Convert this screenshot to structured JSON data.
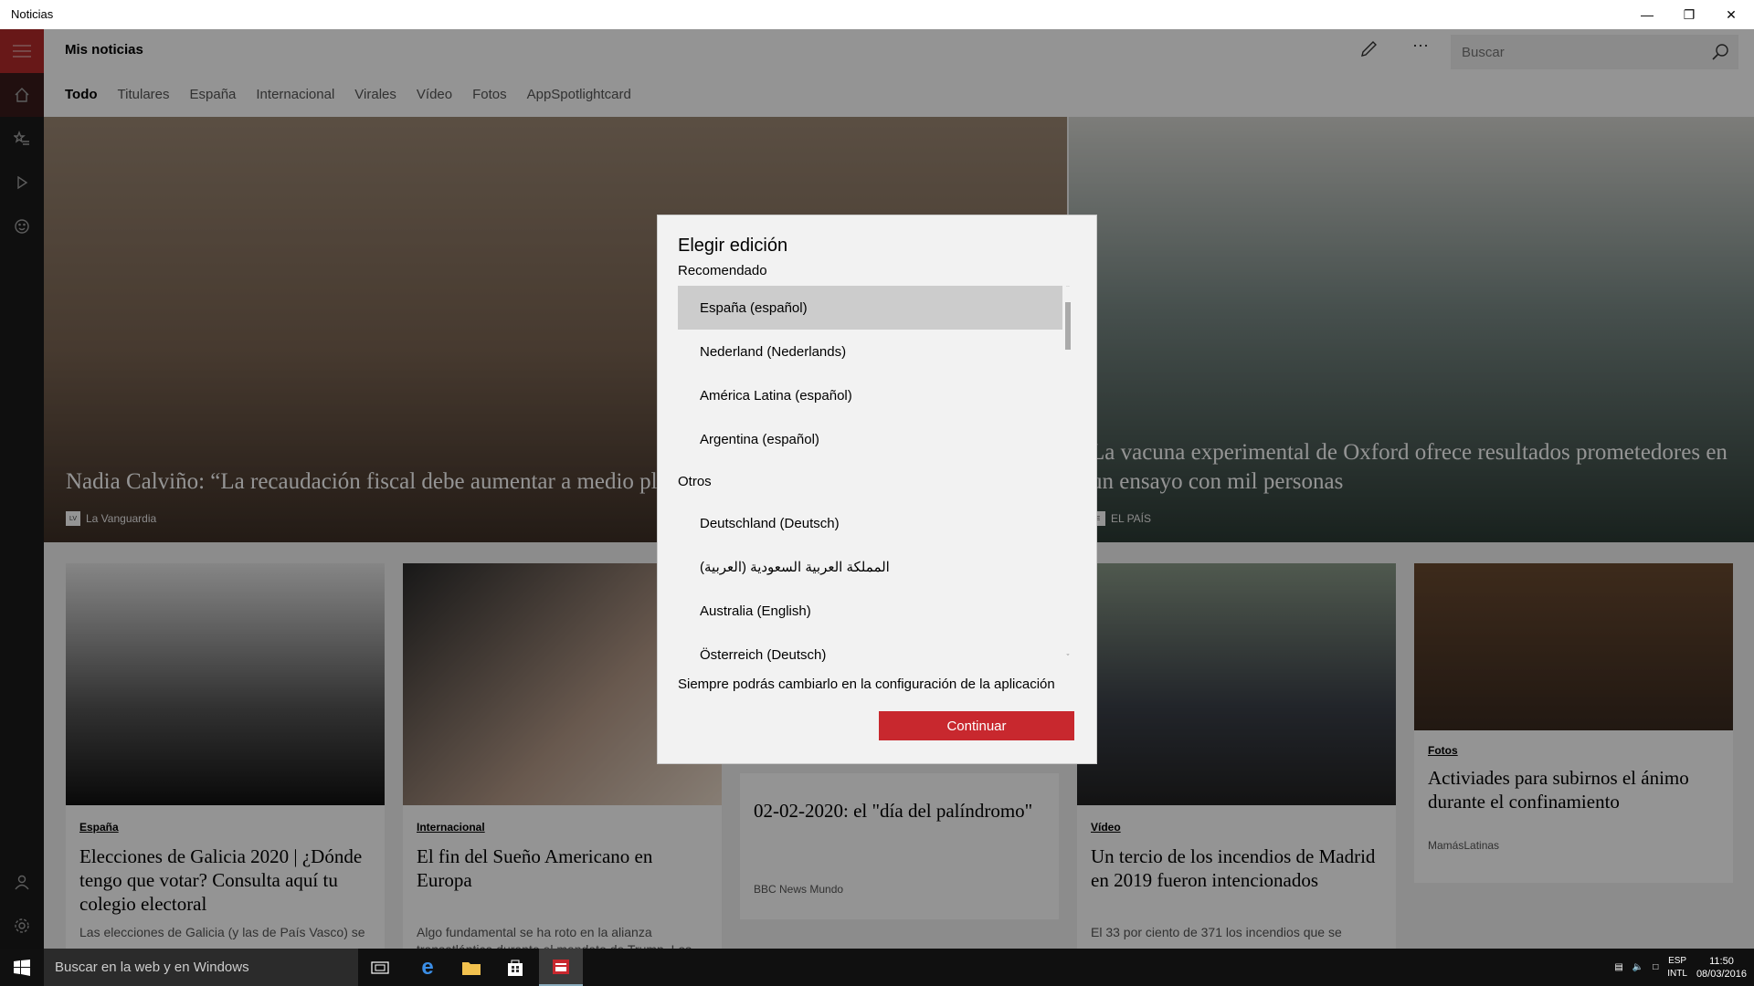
{
  "window": {
    "title": "Noticias"
  },
  "app": {
    "title": "Mis noticias",
    "search_placeholder": "Buscar",
    "tabs": [
      "Todo",
      "Titulares",
      "España",
      "Internacional",
      "Virales",
      "Vídeo",
      "Fotos",
      "AppSpotlightcard"
    ]
  },
  "hero": [
    {
      "headline": "Nadia Calviño: “La recaudación fiscal debe aumentar a medio plazo”",
      "source": "La Vanguardia",
      "logo": "LV"
    },
    {
      "headline": "La vacuna experimental de Oxford ofrece resultados prometedores en un ensayo con mil personas",
      "source": "EL PAÍS",
      "logo": "E"
    }
  ],
  "cards": [
    {
      "category": "España",
      "title": "Elecciones de Galicia 2020 | ¿Dónde tengo que votar? Consulta aquí tu colegio electoral",
      "desc": "Las elecciones de Galicia (y las de País Vasco) se"
    },
    {
      "category": "Internacional",
      "title": "El fin del Sueño Americano en Europa",
      "desc": "Algo fundamental se ha roto en la alianza transatlántica durante el mandato de Trump. Los europeos han perdido la fe en EEUU. Ya no"
    },
    {
      "category": "",
      "title": "02-02-2020: el \"día del palíndromo\"",
      "desc": "BBC News Mundo"
    },
    {
      "category": "Vídeo",
      "title": "Un tercio de los incendios de Madrid en 2019 fueron intencionados",
      "desc": "El 33 por ciento de 371 los incendios que se"
    },
    {
      "category": "Fotos",
      "title": "Activiades para subirnos el ánimo durante el confinamiento",
      "desc": "MamásLatinas"
    }
  ],
  "dialog": {
    "title": "Elegir edición",
    "recommended_label": "Recomendado",
    "recommended": [
      "España (español)",
      "Nederland (Nederlands)",
      "América Latina (español)",
      "Argentina (español)"
    ],
    "others_label": "Otros",
    "others": [
      "Deutschland (Deutsch)",
      "المملكة العربية السعودية (العربية)",
      "Australia (English)",
      "Österreich (Deutsch)"
    ],
    "selected": "España (español)",
    "note": "Siempre podrás cambiarlo en la configuración de la aplicación",
    "continue_label": "Continuar"
  },
  "taskbar": {
    "search_placeholder": "Buscar en la web y en Windows",
    "lang_top": "ESP",
    "lang_bottom": "INTL",
    "time": "11:50",
    "date": "08/03/2016"
  },
  "colors": {
    "accent": "#c8282e",
    "rail": "#1a1a1a",
    "taskbar": "#101010"
  }
}
